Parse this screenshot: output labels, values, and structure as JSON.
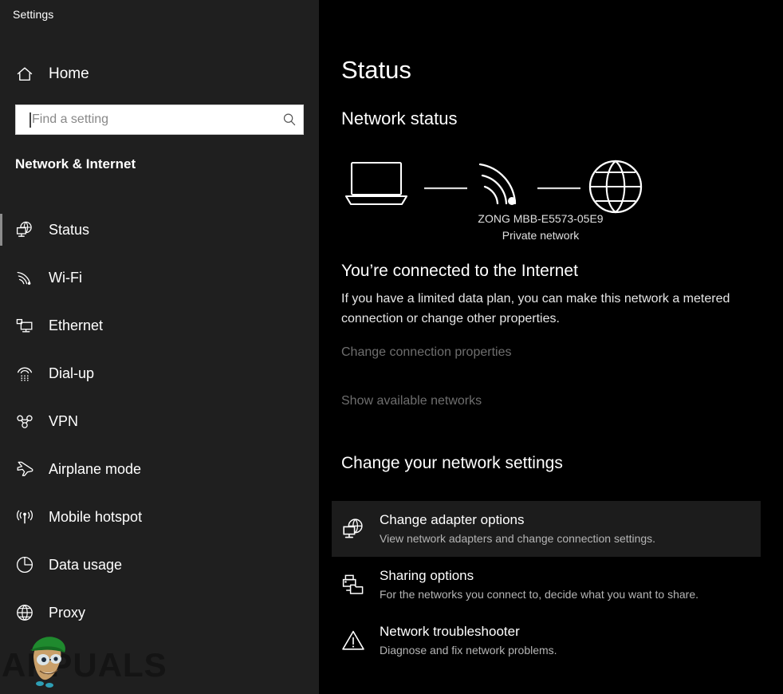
{
  "app": {
    "title": "Settings"
  },
  "sidebar": {
    "home": {
      "label": "Home",
      "icon": "home-icon"
    },
    "search": {
      "value": "",
      "placeholder": "Find a setting",
      "icon": "search-icon"
    },
    "section_title": "Network & Internet",
    "items": [
      {
        "label": "Status",
        "icon": "network-status-icon",
        "selected": true
      },
      {
        "label": "Wi-Fi",
        "icon": "wifi-icon",
        "selected": false
      },
      {
        "label": "Ethernet",
        "icon": "ethernet-icon",
        "selected": false
      },
      {
        "label": "Dial-up",
        "icon": "dialup-icon",
        "selected": false
      },
      {
        "label": "VPN",
        "icon": "vpn-icon",
        "selected": false
      },
      {
        "label": "Airplane mode",
        "icon": "airplane-icon",
        "selected": false
      },
      {
        "label": "Mobile hotspot",
        "icon": "hotspot-icon",
        "selected": false
      },
      {
        "label": "Data usage",
        "icon": "pie-chart-icon",
        "selected": false
      },
      {
        "label": "Proxy",
        "icon": "globe-icon",
        "selected": false
      }
    ],
    "watermark": {
      "text": "APPUALS"
    }
  },
  "main": {
    "page_title": "Status",
    "network_status_title": "Network status",
    "diagram": {
      "device_icon": "laptop-icon",
      "link_icon": "wifi-signal-icon",
      "internet_icon": "globe-icon",
      "network_name": "ZONG MBB-E5573-05E9",
      "network_type": "Private network"
    },
    "connection": {
      "heading": "You’re connected to the Internet",
      "description": "If you have a limited data plan, you can make this network a metered connection or change other properties.",
      "link_properties": "Change connection properties",
      "link_networks": "Show available networks"
    },
    "settings_heading": "Change your network settings",
    "actions": [
      {
        "title": "Change adapter options",
        "subtitle": "View network adapters and change connection settings.",
        "icon": "network-adapter-icon",
        "hovered": true
      },
      {
        "title": "Sharing options",
        "subtitle": "For the networks you connect to, decide what you want to share.",
        "icon": "printer-folder-icon",
        "hovered": false
      },
      {
        "title": "Network troubleshooter",
        "subtitle": "Diagnose and fix network problems.",
        "icon": "warning-triangle-icon",
        "hovered": false
      }
    ]
  },
  "colors": {
    "sidebar_bg": "#1f1f1f",
    "main_bg": "#000000",
    "hover_row": "#1c1c1c",
    "text_primary": "#ffffff",
    "text_secondary": "#b5b5b5",
    "text_dim": "#6e6e6e",
    "selection_bar": "#8c8c8c"
  }
}
